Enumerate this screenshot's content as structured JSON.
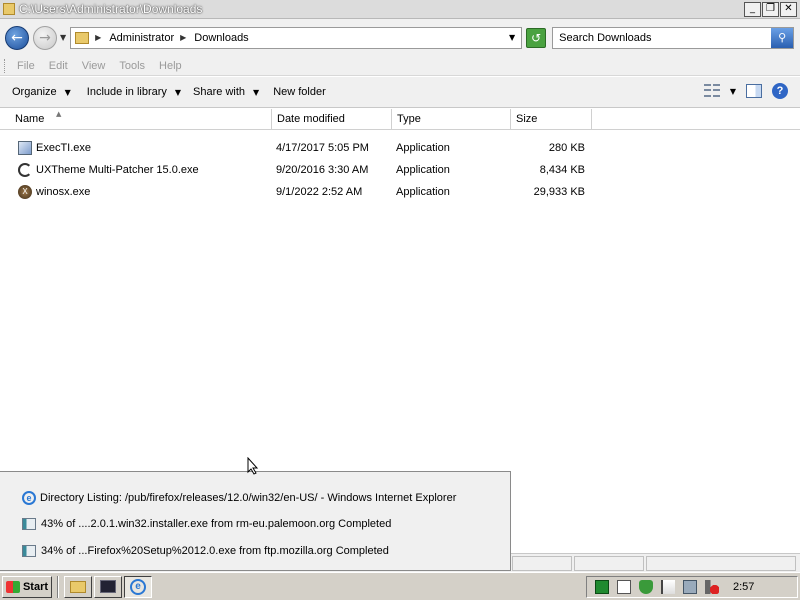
{
  "window": {
    "title": "C:\\Users\\Administrator\\Downloads",
    "buttons": {
      "minimize": "_",
      "maximize": "❐",
      "close": "✕"
    }
  },
  "address": {
    "crumbs": [
      "Administrator",
      "Downloads"
    ],
    "search_placeholder": "Search Downloads"
  },
  "menu": [
    "File",
    "Edit",
    "View",
    "Tools",
    "Help"
  ],
  "commands": [
    "Organize",
    "Include in library",
    "Share with",
    "New folder"
  ],
  "columns": [
    "Name",
    "Date modified",
    "Type",
    "Size"
  ],
  "files": [
    {
      "name": "ExecTI.exe",
      "date": "4/17/2017 5:05 PM",
      "type": "Application",
      "size": "280 KB",
      "icon": "exectl-app-icon"
    },
    {
      "name": "UXTheme Multi-Patcher 15.0.exe",
      "date": "9/20/2016 3:30 AM",
      "type": "Application",
      "size": "8,434 KB",
      "icon": "uxtheme-app-icon"
    },
    {
      "name": "winosx.exe",
      "date": "9/1/2022 2:52 AM",
      "type": "Application",
      "size": "29,933 KB",
      "icon": "winosx-app-icon"
    }
  ],
  "taskbar_popup": [
    {
      "text": "Directory Listing: /pub/firefox/releases/12.0/win32/en-US/ - Windows Internet Explorer",
      "icon": "ie-icon"
    },
    {
      "text": "43% of ....2.0.1.win32.installer.exe from rm-eu.palemoon.org Completed",
      "icon": "download-icon"
    },
    {
      "text": "34% of ...Firefox%20Setup%2012.0.exe from ftp.mozilla.org Completed",
      "icon": "download-icon"
    }
  ],
  "taskbar": {
    "start_label": "Start",
    "clock": "2:57"
  },
  "colors": {
    "title_bar": "#dcdcdc",
    "toolbar_bg": "#f0f0f0",
    "taskbar_bg": "#d4d0c8",
    "accent_blue": "#2a78d4"
  }
}
